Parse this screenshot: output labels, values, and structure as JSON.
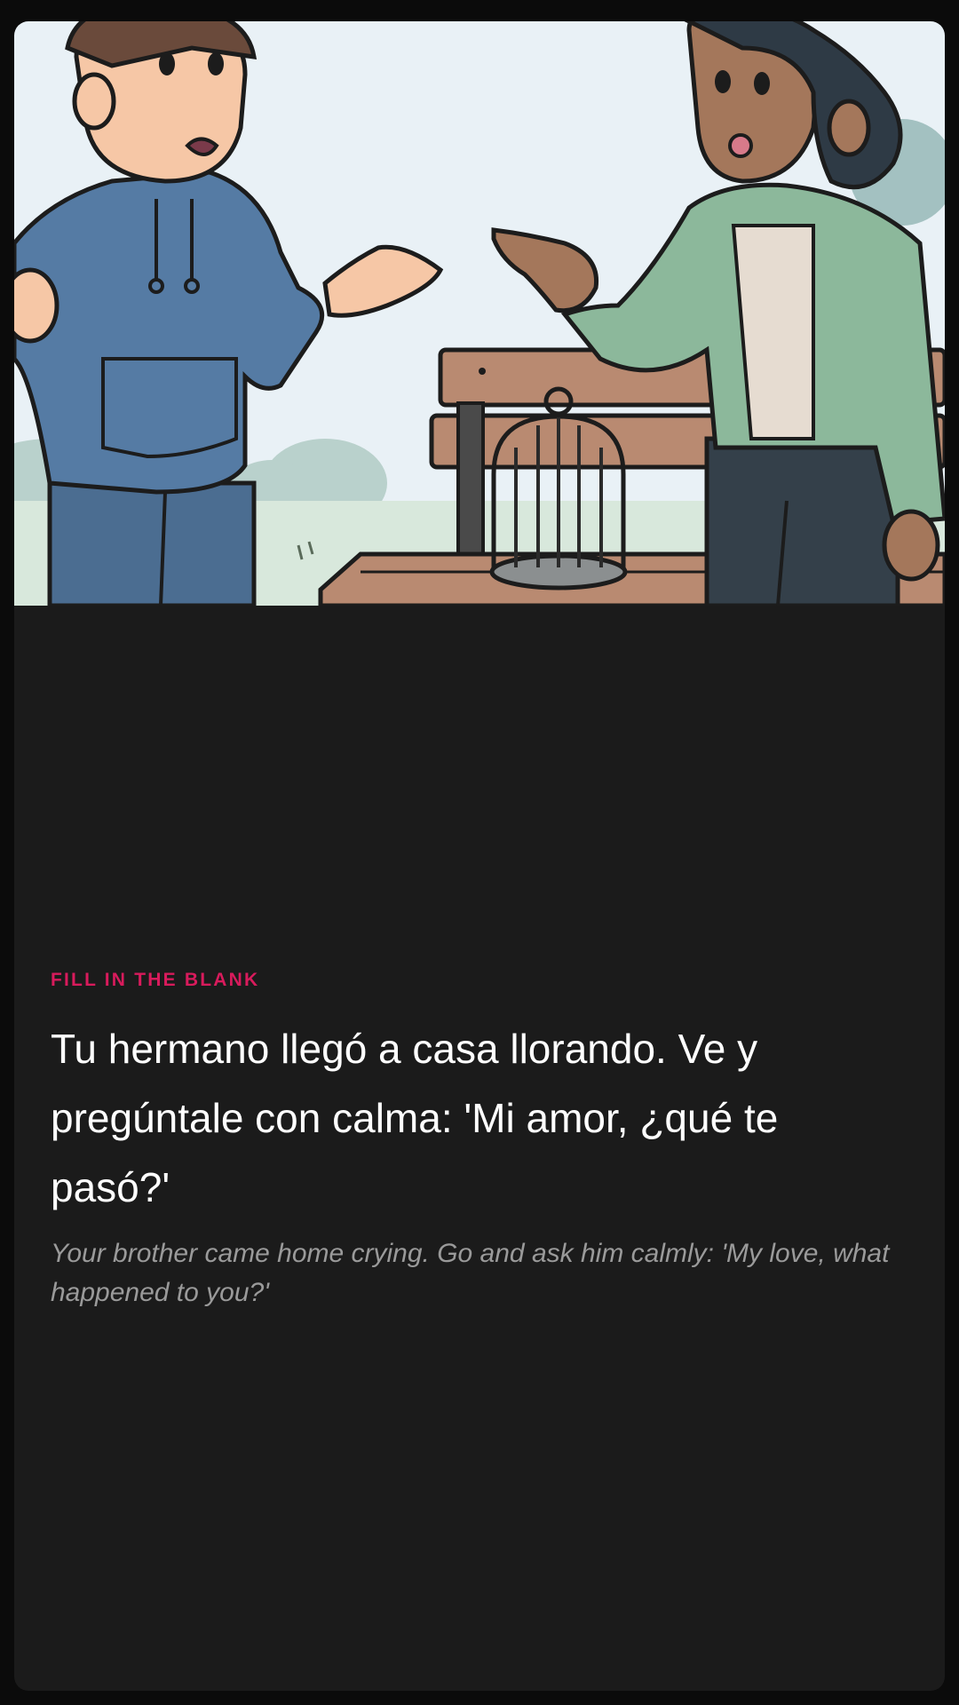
{
  "exercise": {
    "type_label": "FILL IN THE BLANK",
    "prompt": "Tu hermano llegó a casa llorando. Ve y pregúntale con calma: 'Mi amor, ¿qué te pasó?'",
    "translation": "Your brother came home crying. Go and ask him calmly: 'My love, what happened to you?'"
  },
  "illustration": {
    "subject": "two people talking in a park next to a bench with an empty birdcage",
    "icon": "scene-illustration"
  },
  "colors": {
    "background": "#0b0b0b",
    "card": "#1b1b1b",
    "accent": "#d81b5c",
    "prompt_text": "#ffffff",
    "translation_text": "#9a9a9a"
  }
}
